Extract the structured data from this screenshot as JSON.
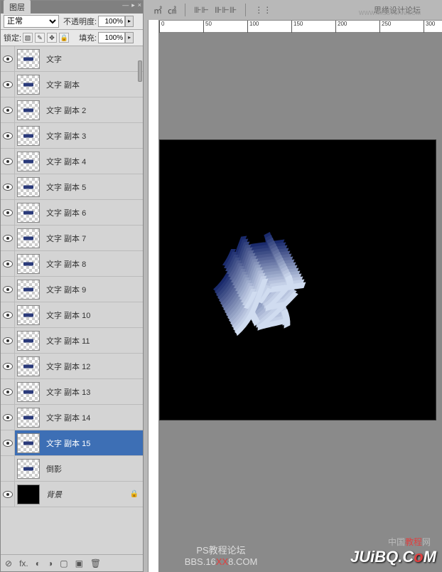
{
  "panel": {
    "title": "图层",
    "blend_mode": "正常",
    "opacity_label": "不透明度:",
    "opacity_value": "100%",
    "lock_label": "锁定:",
    "fill_label": "填充:",
    "fill_value": "100%"
  },
  "lock_icons": [
    "▧",
    "✎",
    "✥",
    "🔒"
  ],
  "layers": [
    {
      "name": "文字",
      "visible": true,
      "selected": false,
      "type": "text"
    },
    {
      "name": "文字 副本",
      "visible": true,
      "selected": false,
      "type": "text"
    },
    {
      "name": "文字 副本 2",
      "visible": true,
      "selected": false,
      "type": "text"
    },
    {
      "name": "文字 副本 3",
      "visible": true,
      "selected": false,
      "type": "text"
    },
    {
      "name": "文字 副本 4",
      "visible": true,
      "selected": false,
      "type": "text"
    },
    {
      "name": "文字 副本 5",
      "visible": true,
      "selected": false,
      "type": "text"
    },
    {
      "name": "文字 副本 6",
      "visible": true,
      "selected": false,
      "type": "text"
    },
    {
      "name": "文字 副本 7",
      "visible": true,
      "selected": false,
      "type": "text"
    },
    {
      "name": "文字 副本 8",
      "visible": true,
      "selected": false,
      "type": "text"
    },
    {
      "name": "文字 副本 9",
      "visible": true,
      "selected": false,
      "type": "text"
    },
    {
      "name": "文字 副本 10",
      "visible": true,
      "selected": false,
      "type": "text"
    },
    {
      "name": "文字 副本 11",
      "visible": true,
      "selected": false,
      "type": "text"
    },
    {
      "name": "文字 副本 12",
      "visible": true,
      "selected": false,
      "type": "text"
    },
    {
      "name": "文字 副本 13",
      "visible": true,
      "selected": false,
      "type": "text"
    },
    {
      "name": "文字 副本 14",
      "visible": true,
      "selected": false,
      "type": "text"
    },
    {
      "name": "文字 副本 15",
      "visible": true,
      "selected": true,
      "type": "text"
    },
    {
      "name": "倒影",
      "visible": false,
      "selected": false,
      "type": "text"
    },
    {
      "name": "背景",
      "visible": true,
      "selected": false,
      "type": "bg"
    }
  ],
  "toolbar": {
    "brand": "思缘设计论坛",
    "brand_url": "WWW.MISSYUAN.COM"
  },
  "ruler_ticks": [
    "0",
    "50",
    "100",
    "150",
    "200",
    "250",
    "300"
  ],
  "canvas_text": "炫",
  "footer": {
    "line1": "PS教程论坛",
    "line2_pre": "BBS.16",
    "line2_red": "XX",
    "line2_post": "8.COM"
  },
  "watermark": "JUiBQ.CoM",
  "cn_watermark_pre": "中国",
  "cn_watermark_red": "教程",
  "cn_watermark_post": "网",
  "footer_icons": [
    "⊘",
    "fx.",
    "◐",
    "◑",
    "▢",
    "▣",
    "🗑"
  ],
  "colors": {
    "selected": "#3d6fb5",
    "text3d_top": "#1a2a6c",
    "text3d_bottom": "#d0dcf0"
  }
}
